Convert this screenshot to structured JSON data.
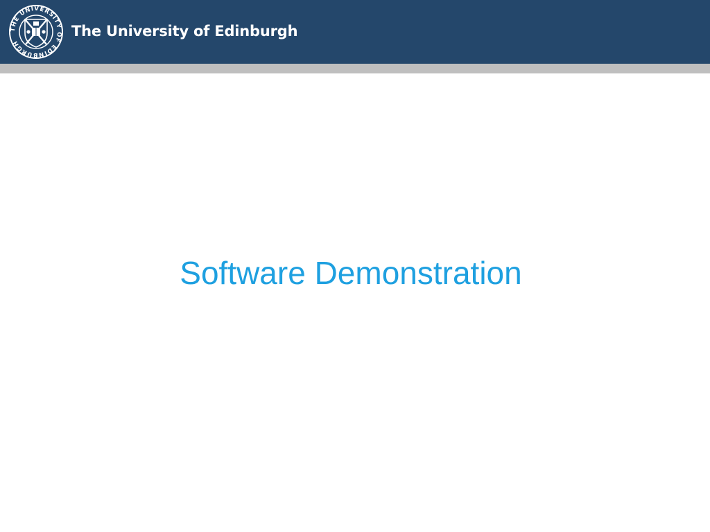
{
  "header": {
    "university_name": "The University of Edinburgh",
    "crest_icon": "university-crest-icon",
    "crest_text": "THE UNIVERSITY OF EDINBURGH",
    "background_color": "#24476b",
    "rule_color": "#bfbfbf"
  },
  "slide": {
    "title": "Software Demonstration",
    "title_color": "#1ea0e0"
  }
}
